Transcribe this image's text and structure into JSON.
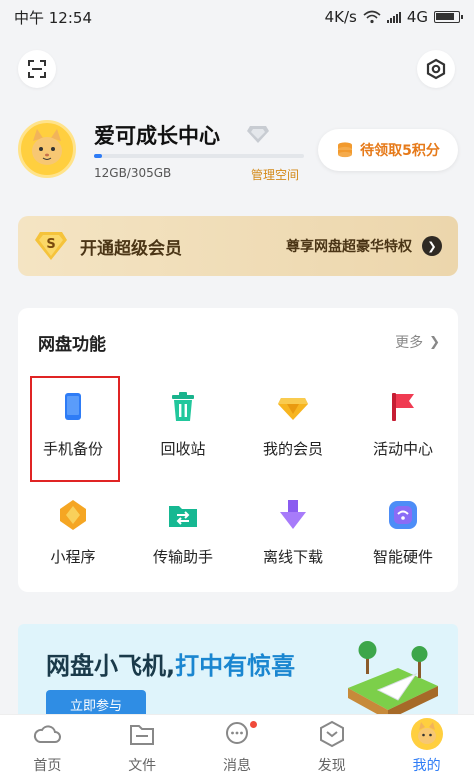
{
  "status_bar": {
    "time": "中午 12:54",
    "network_speed": "4K/s",
    "network_type": "4G"
  },
  "profile": {
    "username": "爱可成长中心",
    "storage_text": "12GB/305GB",
    "storage_fraction": 0.04,
    "manage_label": "管理空间",
    "points_label": "待领取5积分"
  },
  "vip_banner": {
    "title": "开通超级会员",
    "subtitle": "尊享网盘超豪华特权"
  },
  "functions": {
    "title": "网盘功能",
    "more_label": "更多",
    "items": [
      {
        "label": "手机备份",
        "icon": "phone-backup-icon"
      },
      {
        "label": "回收站",
        "icon": "recycle-bin-icon"
      },
      {
        "label": "我的会员",
        "icon": "membership-diamond-icon"
      },
      {
        "label": "活动中心",
        "icon": "activity-flag-icon"
      },
      {
        "label": "小程序",
        "icon": "mini-program-icon"
      },
      {
        "label": "传输助手",
        "icon": "transfer-folder-icon"
      },
      {
        "label": "离线下载",
        "icon": "offline-download-icon"
      },
      {
        "label": "智能硬件",
        "icon": "smart-hardware-icon"
      }
    ]
  },
  "promo": {
    "title_part1": "网盘小飞机,",
    "title_part2": "打中有惊喜",
    "button_label": "立即参与"
  },
  "tabs": [
    {
      "label": "首页",
      "icon": "cloud-icon"
    },
    {
      "label": "文件",
      "icon": "folder-icon"
    },
    {
      "label": "消息",
      "icon": "message-icon"
    },
    {
      "label": "发现",
      "icon": "discover-icon"
    },
    {
      "label": "我的",
      "icon": "avatar-icon"
    }
  ],
  "colors": {
    "accent_blue": "#2e7cf6",
    "points_orange": "#e67a1a",
    "vip_gold": "#ecd6ac",
    "highlight_red": "#e02424"
  }
}
